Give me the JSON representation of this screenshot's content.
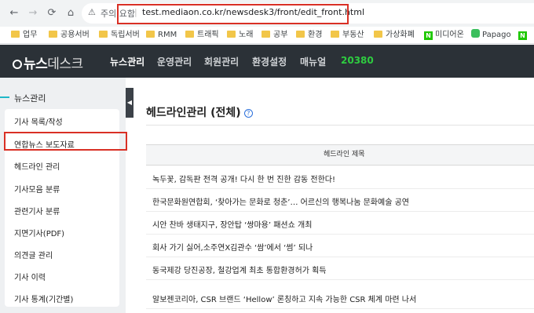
{
  "browser": {
    "warning_text": "주의 요함",
    "url": "test.mediaon.co.kr/newsdesk3/front/edit_front.html"
  },
  "bookmarks": [
    {
      "label": "업무",
      "icon": "folder-icon"
    },
    {
      "label": "공용서버",
      "icon": "folder-icon"
    },
    {
      "label": "독립서버",
      "icon": "folder-icon"
    },
    {
      "label": "RMM",
      "icon": "folder-icon"
    },
    {
      "label": "트래픽",
      "icon": "folder-icon"
    },
    {
      "label": "노래",
      "icon": "folder-icon"
    },
    {
      "label": "공부",
      "icon": "folder-icon"
    },
    {
      "label": "환경",
      "icon": "folder-icon"
    },
    {
      "label": "부동산",
      "icon": "folder-icon"
    },
    {
      "label": "가상화폐",
      "icon": "folder-icon"
    },
    {
      "label": "미디어온",
      "icon": "naver-n-icon"
    },
    {
      "label": "Papago",
      "icon": "papago-icon"
    },
    {
      "label": "N",
      "icon": "naver-n-icon"
    }
  ],
  "header": {
    "logo": {
      "bold": "뉴스",
      "light": "데스크"
    },
    "nav": [
      {
        "label": "뉴스관리",
        "active": true
      },
      {
        "label": "운영관리",
        "active": false
      },
      {
        "label": "회원관리",
        "active": false
      },
      {
        "label": "환경설정",
        "active": false
      },
      {
        "label": "매뉴얼",
        "active": false
      }
    ],
    "count": "20380"
  },
  "sidebar": {
    "title": "뉴스관리",
    "items": [
      {
        "label": "기사 목록/작성"
      },
      {
        "label": "연합뉴스 보도자료",
        "highlighted": true
      },
      {
        "label": "헤드라인 관리"
      },
      {
        "label": "기사모음 분류"
      },
      {
        "label": "관련기사 분류"
      },
      {
        "label": "지면기사(PDF)"
      },
      {
        "label": "의견글 관리"
      },
      {
        "label": "기사 이력"
      },
      {
        "label": "기사 통계(기간별)"
      }
    ],
    "collapse_icon": "triangle-left-icon"
  },
  "main": {
    "title": "헤드라인관리 (전체)",
    "help_icon": "question-circle-icon",
    "help_glyph": "?",
    "table": {
      "header": "헤드라인 제목",
      "rows": [
        "녹두꽃, 감독판 전격 공개! 다시 한 번 진한 감동 전한다!",
        "한국문화원연합회, ‘찾아가는 문화로 청춘’… 어르신의 행복나눔 문화예술 공연",
        "시안 찬바 생태지구, 장안탑 ‘쌍마용’ 패션쇼 개최",
        "회사 가기 싫어,소주연X김관수 ‘쌈’에서 ‘썸’ 되나",
        "동국제강 당진공장, 철강업계 최초 통합환경허가 획득",
        "알보젠코리아, CSR 브랜드 ‘Hellow’ 론칭하고 지속 가능한 CSR 체계 마련 나서"
      ]
    }
  },
  "colors": {
    "header_bg": "#2b3137",
    "accent_green": "#2ecc40",
    "highlight_red": "#d93025",
    "sidebar_accent": "#1fb8c8"
  }
}
